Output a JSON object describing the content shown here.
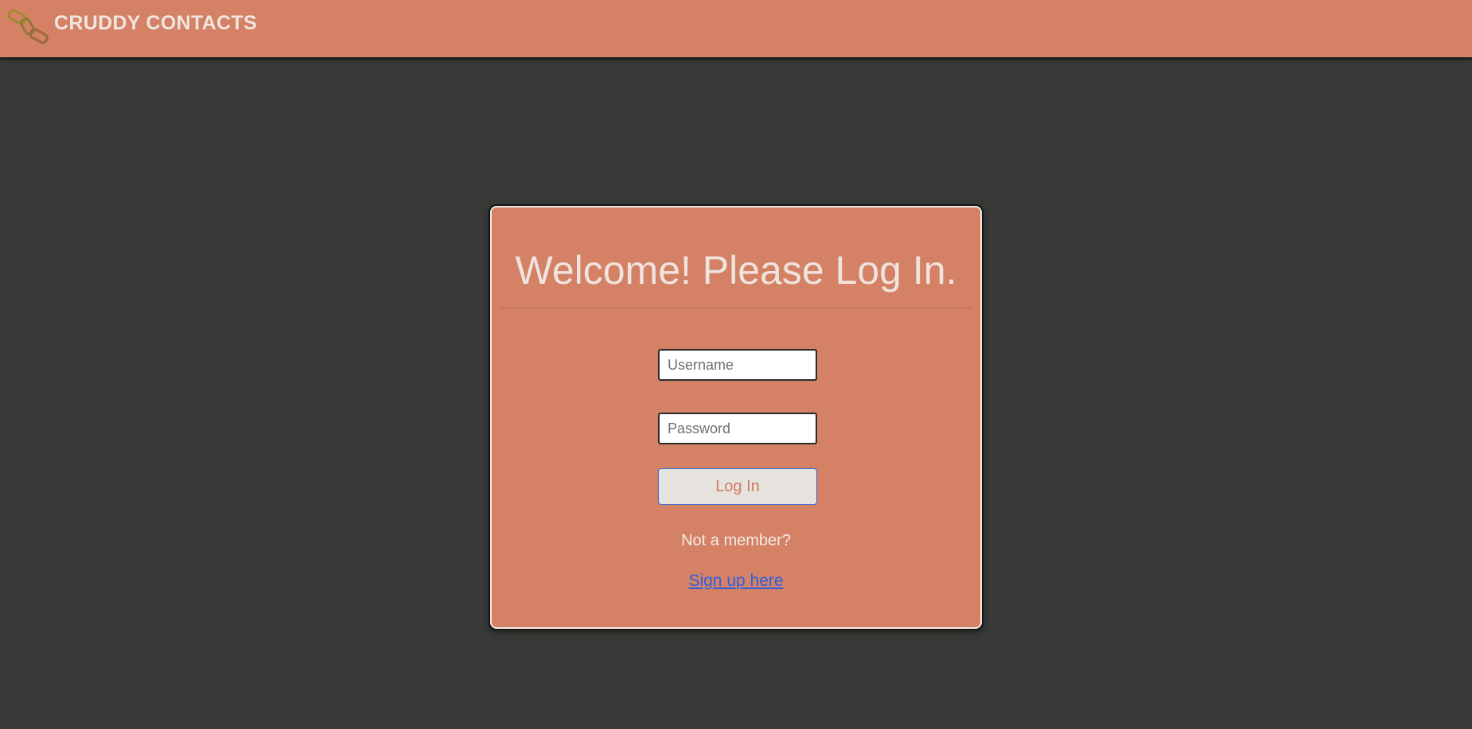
{
  "header": {
    "brand": "CRUDDY CONTACTS",
    "logo_icon": "chain-link-icon",
    "background_color": "#d48165"
  },
  "login_card": {
    "title": "Welcome! Please Log In.",
    "username": {
      "placeholder": "Username",
      "value": ""
    },
    "password": {
      "placeholder": "Password",
      "value": ""
    },
    "login_button_label": "Log In",
    "not_member_text": "Not a member?",
    "signup_link_text": "Sign up here"
  },
  "colors": {
    "page_background": "#383a37",
    "accent": "#d48165",
    "link": "#2f5fe0"
  }
}
